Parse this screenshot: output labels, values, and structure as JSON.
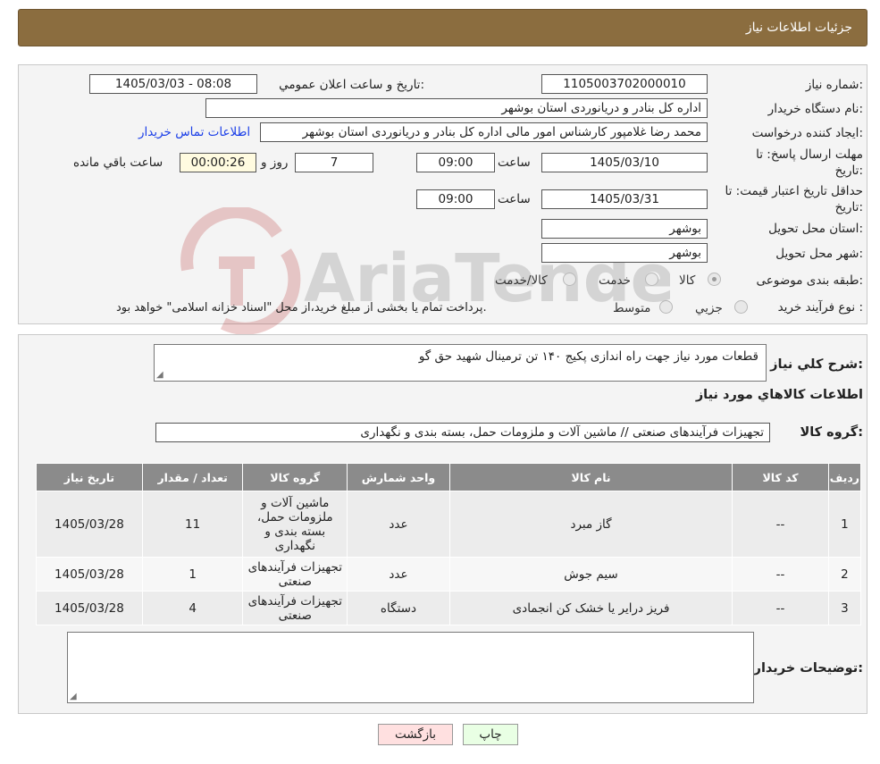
{
  "header": {
    "title": "جزئیات اطلاعات نیاز"
  },
  "watermark": {
    "text": "AriaTender.neT"
  },
  "form": {
    "need_number_label": "شماره نیاز:",
    "need_number": "1105003702000010",
    "announce_label": "تاریخ و ساعت اعلان عمومي:",
    "announce_value": "1405/03/03 - 08:08",
    "buyer_org_label": "نام دستگاه خريدار:",
    "buyer_org": "اداره کل بنادر و دریانوردی استان بوشهر",
    "creator_label": "ايجاد کننده درخواست:",
    "creator": "محمد رضا غلامپور کارشناس امور مالی اداره کل بنادر و دریانوردی استان بوشهر",
    "contact_link": "اطلاعات تماس خریدار",
    "deadline_label_1": "مهلت ارسال پاسخ: تا",
    "deadline_label_2": "تاریخ:",
    "deadline_date": "1405/03/10",
    "time_label": "ساعت",
    "deadline_time": "09:00",
    "days": "7",
    "days_label": "روز و",
    "remaining": "00:00:26",
    "remaining_label": "ساعت باقي مانده",
    "price_validity_label_1": "حداقل تاریخ اعتبار قیمت: تا",
    "price_validity_label_2": "تاریخ:",
    "price_validity_date": "1405/03/31",
    "price_validity_time": "09:00",
    "province_label": "استان محل تحویل:",
    "province": "بوشهر",
    "city_label": "شهر محل تحویل:",
    "city": "بوشهر",
    "category_label": "طبقه بندی موضوعی:",
    "category_options": [
      "کالا",
      "خدمت",
      "کالا/خدمت"
    ],
    "category_selected": "کالا",
    "process_label": "نوع فرآیند خرید :",
    "process_options": [
      "جزیي",
      "متوسط"
    ],
    "process_note": "پرداخت تمام یا بخشی از مبلغ خرید،از محل \"اسناد خزانه اسلامی\" خواهد بود."
  },
  "details": {
    "summary_label": "شرح کلي نياز:",
    "summary": "قطعات مورد نیاز جهت راه اندازی پکیج ۱۴۰ تن ترمینال شهید حق گو",
    "goods_info_title": "اطلاعات کالاهاي مورد نياز",
    "goods_group_label": "گروه کالا:",
    "goods_group": "تجهیزات فرآیندهای صنعتی // ماشین آلات و ملزومات حمل، بسته بندی و نگهداری",
    "columns": [
      "رديف",
      "کد کالا",
      "نام کالا",
      "واحد شمارش",
      "گروه کالا",
      "تعداد / مقدار",
      "تاریخ نیاز"
    ],
    "rows": [
      {
        "idx": "1",
        "code": "--",
        "name": "گاز مبرد",
        "unit": "عدد",
        "group": "ماشین آلات و ملزومات حمل، بسته بندی و نگهداری",
        "qty": "11",
        "date": "1405/03/28"
      },
      {
        "idx": "2",
        "code": "--",
        "name": "سیم جوش",
        "unit": "عدد",
        "group": "تجهیزات فرآیندهای صنعتی",
        "qty": "1",
        "date": "1405/03/28"
      },
      {
        "idx": "3",
        "code": "--",
        "name": "فریز درایر یا خشک کن انجمادی",
        "unit": "دستگاه",
        "group": "تجهیزات فرآیندهای صنعتی",
        "qty": "4",
        "date": "1405/03/28"
      }
    ],
    "buyer_notes_label": "توضيحات خريدار:",
    "buyer_notes": ""
  },
  "buttons": {
    "print": "چاپ",
    "back": "بازگشت"
  },
  "colors": {
    "header": "#8b6d3f",
    "table_header": "#8b8b8b",
    "print_btn": "#e9ffe4",
    "back_btn": "#ffe0e0"
  }
}
